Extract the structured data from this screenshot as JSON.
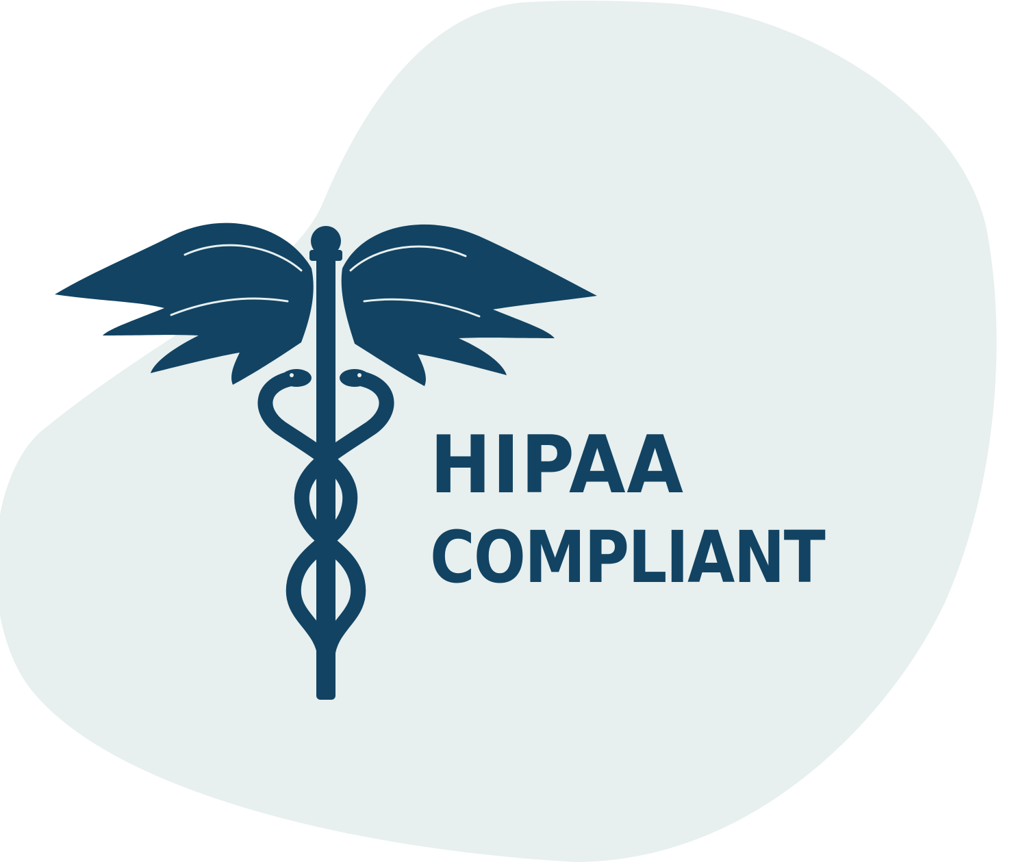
{
  "badge": {
    "line1": "HIPAA",
    "line2": "COMPLIANT"
  },
  "emblem": {
    "icon": "caduceus-icon"
  },
  "colors": {
    "brand": "#124362",
    "background_blob": "#e7efef",
    "page": "#ffffff"
  }
}
